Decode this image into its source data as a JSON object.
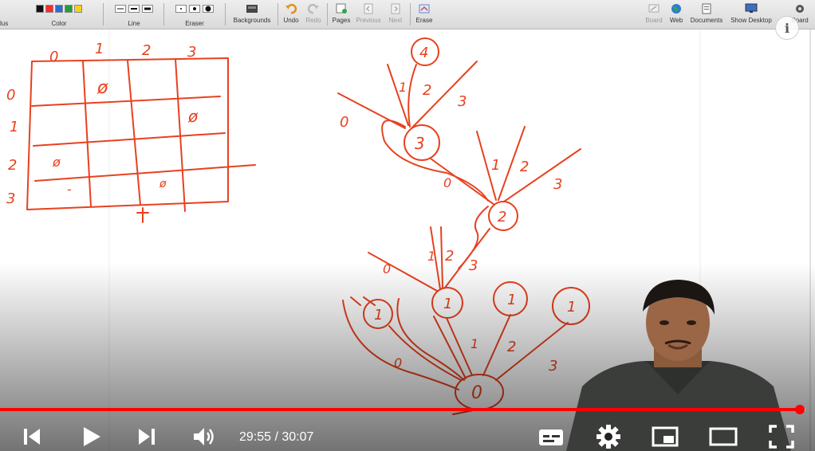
{
  "toolbar": {
    "color_label": "Color",
    "line_label": "Line",
    "eraser_label": "Eraser",
    "backgrounds_label": "Backgrounds",
    "undo_label": "Undo",
    "redo_label": "Redo",
    "pages_label": "Pages",
    "previous_label": "Previous",
    "next_label": "Next",
    "erase_label": "Erase",
    "board_label": "Board",
    "web_label": "Web",
    "documents_label": "Documents",
    "show_desktop_label": "Show Desktop",
    "right_board_label": "Board",
    "left_cut_label": "lus",
    "swatch_colors": [
      "#111111",
      "#ff2a2a",
      "#2a6cd6",
      "#1fa03a",
      "#f4d21a"
    ]
  },
  "grid": {
    "col_headers": [
      "0",
      "1",
      "2",
      "3"
    ],
    "row_headers": [
      "0",
      "1",
      "2",
      "3"
    ],
    "marks": [
      "ø",
      "ø",
      "ø",
      "-",
      "ø"
    ]
  },
  "tree": {
    "edge_labels": [
      "0",
      "1",
      "2",
      "3"
    ],
    "node_labels": [
      "4",
      "3",
      "2",
      "1",
      "1",
      "1",
      "1",
      "0"
    ]
  },
  "player": {
    "current_time": "29:55",
    "duration": "30:07",
    "time_display": "29:55 / 30:07",
    "progress": 0.9934,
    "accent": "#ff0000"
  },
  "ink_color": "#e8411f"
}
